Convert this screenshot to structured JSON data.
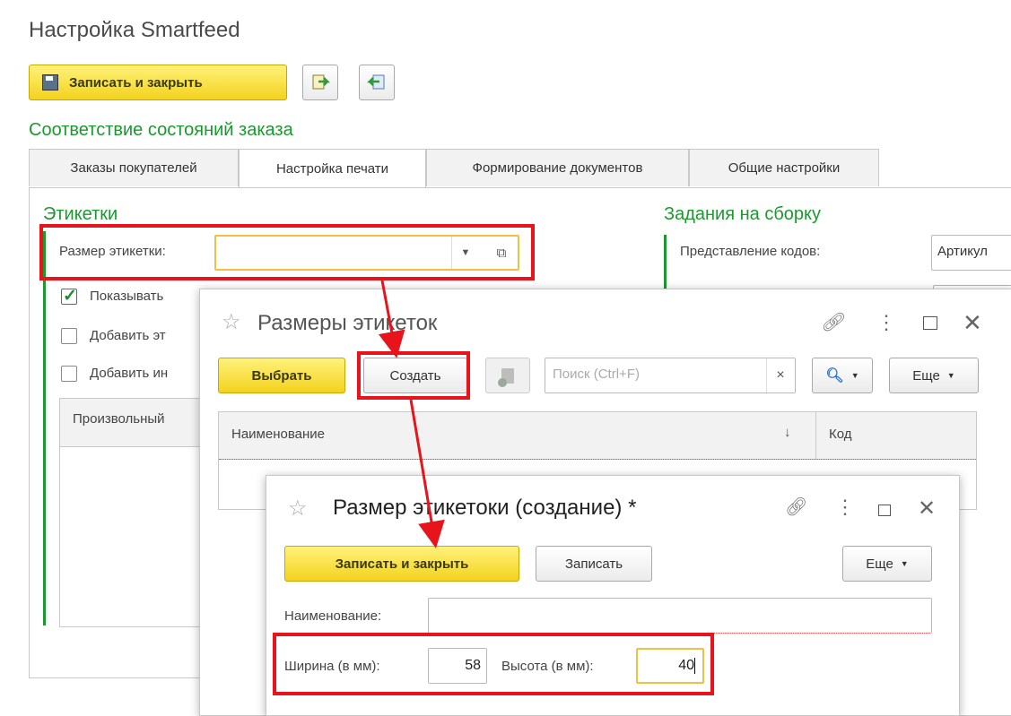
{
  "window_title": "Настройка Smartfeed",
  "toolbar": {
    "save_close_label": "Записать и закрыть"
  },
  "section_title": "Соответствие состояний заказа",
  "tabs": [
    {
      "label": "Заказы покупателей"
    },
    {
      "label": "Настройка печати"
    },
    {
      "label": "Формирование документов"
    },
    {
      "label": "Общие настройки"
    }
  ],
  "labels_group": {
    "title": "Этикетки",
    "size_label": "Размер этикетки:",
    "size_value": "",
    "show_label": "Показывать",
    "add1_label": "Добавить эт",
    "add2_label": "Добавить ин",
    "table_header": "Произвольный"
  },
  "assembly_group": {
    "title": "Задания на сборку",
    "codes_label": "Представление кодов:",
    "codes_value": "Артикул"
  },
  "dialog1": {
    "title": "Размеры этикеток",
    "select_label": "Выбрать",
    "create_label": "Создать",
    "search_placeholder": "Поиск (Ctrl+F)",
    "search_clear": "×",
    "more_label": "Еще",
    "col_name": "Наименование",
    "col_sort": "↓",
    "col_code": "Код"
  },
  "dialog2": {
    "title": "Размер этикетоки (создание) *",
    "save_close_label": "Записать и закрыть",
    "save_label": "Записать",
    "more_label": "Еще",
    "name_label": "Наименование:",
    "name_value": "",
    "width_label": "Ширина (в мм):",
    "width_value": "58",
    "height_label": "Высота (в мм):",
    "height_value": "40"
  },
  "colors": {
    "accent_green": "#1a9a2e",
    "highlight_red": "#e8141b",
    "button_yellow": "#f3d21e",
    "focus_orange": "#f0c040"
  }
}
